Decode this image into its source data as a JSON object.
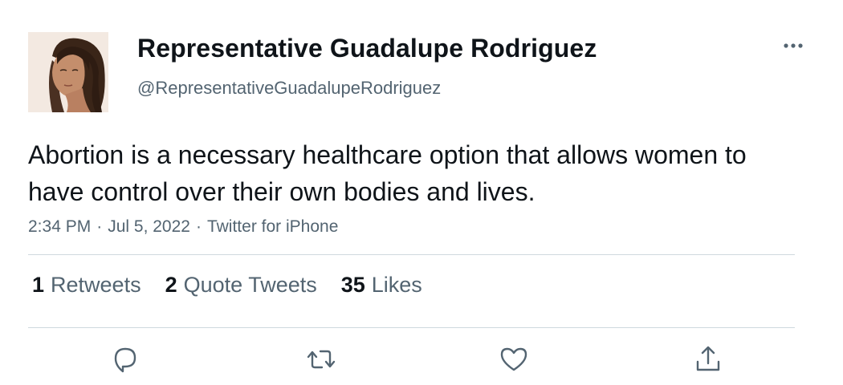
{
  "author": {
    "display_name": "Representative Guadalupe Rodriguez",
    "handle": "@RepresentativeGuadalupeRodriguez"
  },
  "tweet": {
    "text": "Abortion is a necessary healthcare option that allows women to have control over their own bodies and lives.",
    "time": "2:34 PM",
    "date": "Jul 5, 2022",
    "source": "Twitter for iPhone",
    "separator": "·"
  },
  "stats": {
    "retweets_count": "1",
    "retweets_label": "Retweets",
    "quotes_count": "2",
    "quotes_label": "Quote Tweets",
    "likes_count": "35",
    "likes_label": "Likes"
  },
  "icons": {
    "more": "more-horizontal-icon",
    "reply": "reply-icon",
    "retweet": "retweet-icon",
    "like": "heart-icon",
    "share": "share-icon"
  },
  "colors": {
    "text_primary": "#0f1419",
    "text_secondary": "#536471",
    "divider": "#cfd9de"
  }
}
